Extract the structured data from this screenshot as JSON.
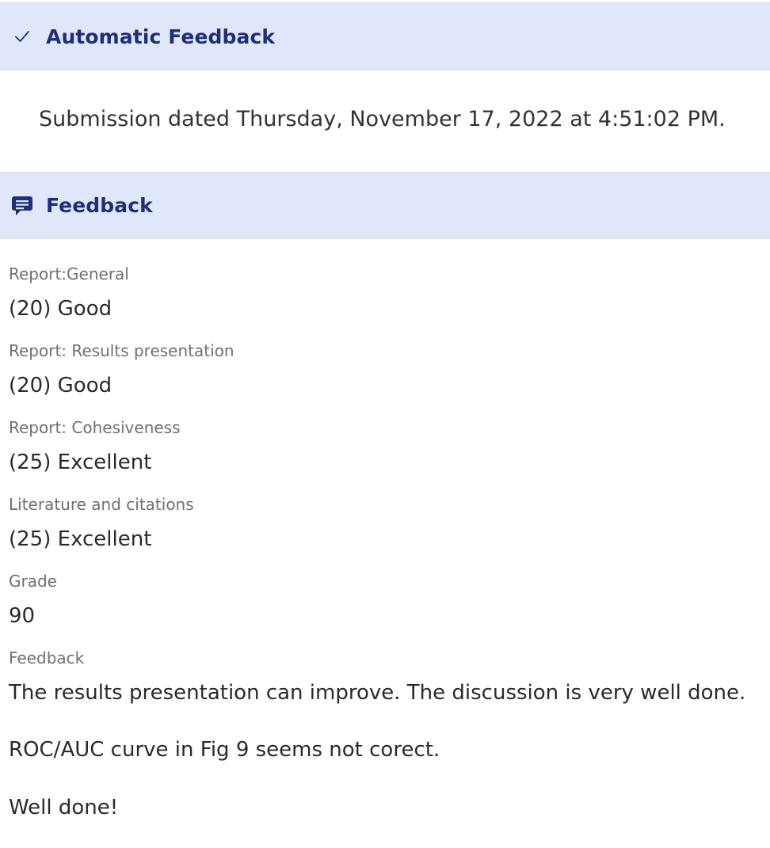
{
  "automatic_feedback": {
    "title": "Automatic Feedback",
    "icon": "check-icon",
    "submission_text": "Submission dated Thursday, November 17, 2022 at 4:51:02 PM."
  },
  "feedback": {
    "title": "Feedback",
    "icon": "comment-icon",
    "fields": [
      {
        "label": "Report:General",
        "value": "(20) Good"
      },
      {
        "label": "Report: Results presentation",
        "value": "(20) Good"
      },
      {
        "label": "Report: Cohesiveness",
        "value": "(25) Excellent"
      },
      {
        "label": "Literature and citations",
        "value": "(25) Excellent"
      },
      {
        "label": "Grade",
        "value": "90"
      }
    ],
    "feedback_label": "Feedback",
    "feedback_paragraphs": [
      " The results presentation can improve. The discussion is very well done.",
      "ROC/AUC curve in Fig 9 seems not corect.",
      "Well done!"
    ]
  },
  "colors": {
    "header_background": "#e1e7fa",
    "header_text": "#1f2e7a",
    "label_text": "#707070",
    "body_text": "#2a2a2a"
  }
}
